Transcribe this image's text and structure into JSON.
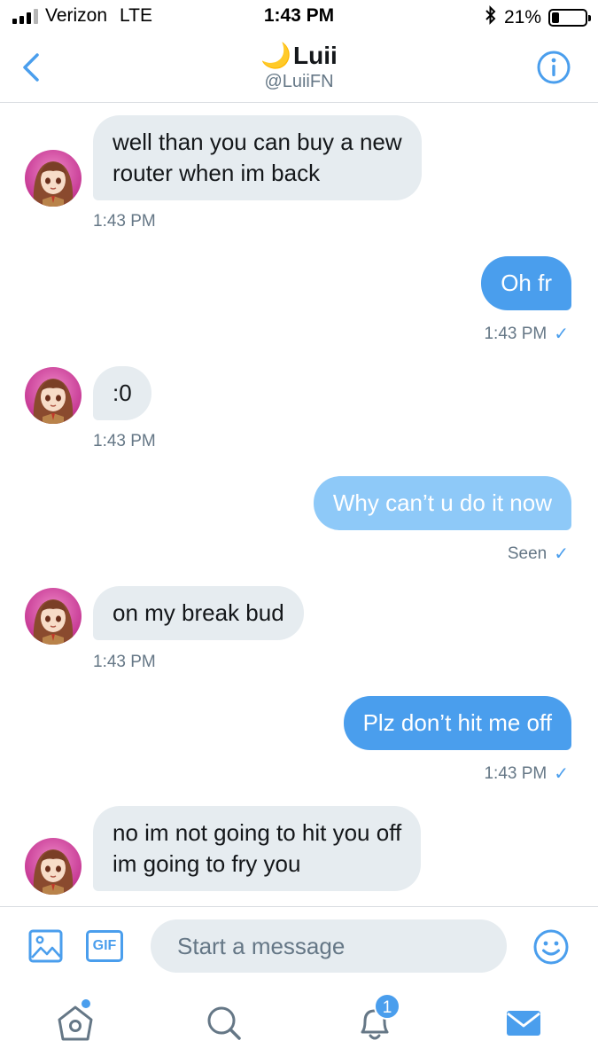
{
  "status_bar": {
    "carrier": "Verizon",
    "network": "LTE",
    "time": "1:43 PM",
    "battery_percent_label": "21%",
    "battery_level": 0.21,
    "signal_bars": 3,
    "bluetooth_icon": "bluetooth-icon"
  },
  "header": {
    "name": "Luii",
    "name_emoji": "🌙",
    "handle": "@LuiiFN",
    "back_icon": "chevron-left-icon",
    "info_icon": "info-icon"
  },
  "messages": [
    {
      "direction": "incoming",
      "text": "well than you can buy a new\nrouter when im back",
      "meta": "1:43 PM"
    },
    {
      "direction": "outgoing",
      "text": "Oh fr",
      "meta": "1:43 PM",
      "check": "✓"
    },
    {
      "direction": "incoming",
      "text": ":0",
      "meta": "1:43 PM"
    },
    {
      "direction": "outgoing",
      "text": "Why can’t u do it now",
      "meta": "Seen",
      "check": "✓"
    },
    {
      "direction": "incoming",
      "text": "on my break bud",
      "meta": "1:43 PM"
    },
    {
      "direction": "outgoing",
      "text": "Plz don’t hit me off",
      "meta": "1:43 PM",
      "check": "✓"
    },
    {
      "direction": "incoming",
      "text": "no im not going to hit you off\nim going to fry you",
      "meta": ""
    }
  ],
  "composer": {
    "placeholder": "Start a message",
    "gif_label": "GIF"
  },
  "tabbar": {
    "notifications_count": "1"
  },
  "colors": {
    "accent": "#4a9eed",
    "incoming_bubble": "#e6ecf0",
    "outgoing_pending": "#8ec9f8",
    "meta_text": "#657786"
  }
}
